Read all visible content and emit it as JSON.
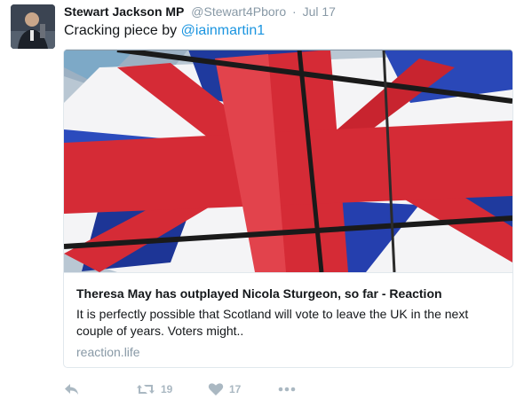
{
  "tweet": {
    "author_name": "Stewart Jackson MP",
    "handle": "@Stewart4Pboro",
    "separator": "·",
    "time": "Jul 17",
    "text_prefix": "Cracking piece by ",
    "mention": "@iainmartin1"
  },
  "card": {
    "title": "Theresa May has outplayed Nicola Sturgeon, so far - Reaction",
    "description": "It is perfectly possible that Scotland will vote to leave the UK in the next couple of years. Voters might..",
    "domain": "reaction.life",
    "image_icon": "union-jack-flag-image"
  },
  "actions": {
    "reply_icon": "reply-icon",
    "retweet_icon": "retweet-icon",
    "retweet_count": "19",
    "like_icon": "heart-icon",
    "like_count": "17",
    "more_icon": "more-icon"
  },
  "colors": {
    "link": "#1b95e0",
    "muted": "#8899a6",
    "action": "#aab8c2",
    "flag_red": "#d52b36",
    "flag_blue": "#1f3a9e"
  }
}
